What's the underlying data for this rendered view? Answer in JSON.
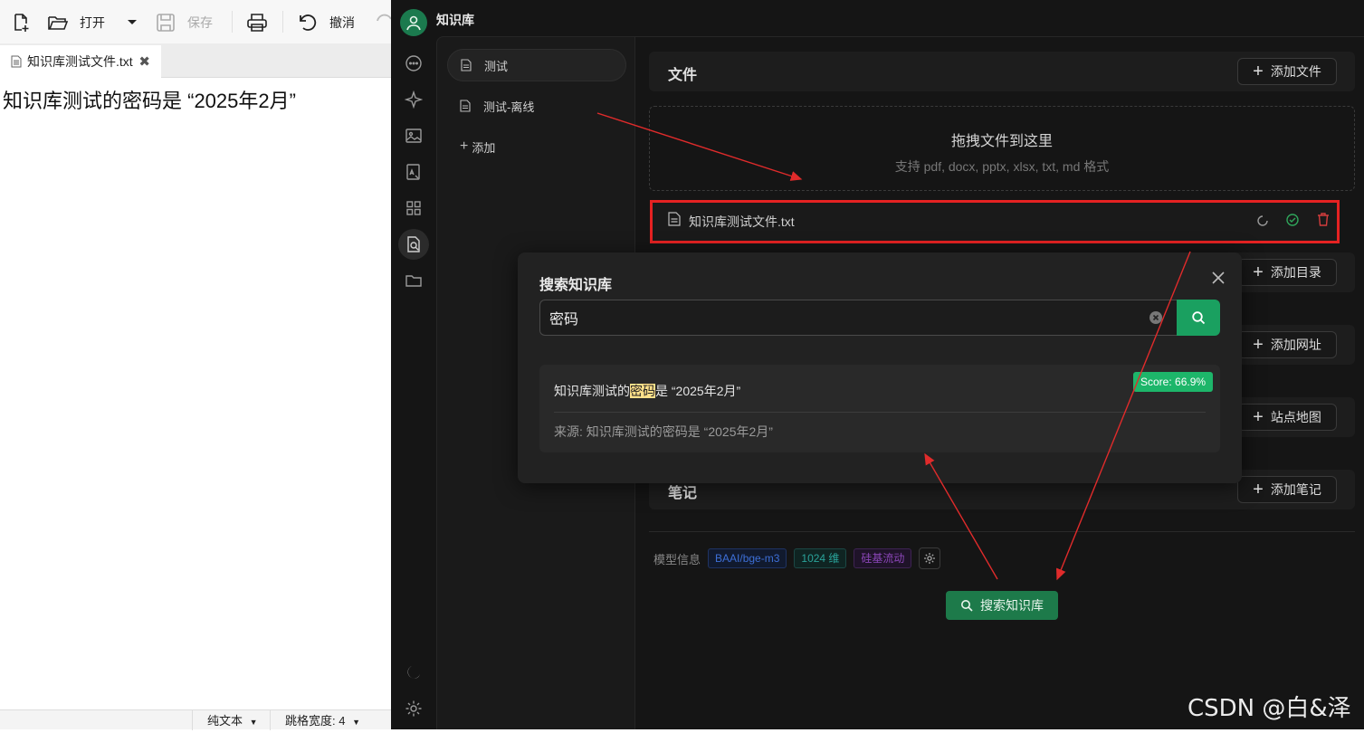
{
  "editor": {
    "toolbar": {
      "open": "打开",
      "save": "保存",
      "undo": "撤消"
    },
    "tab": {
      "title": "知识库测试文件.txt"
    },
    "content": "知识库测试的密码是 “2025年2月”",
    "status": {
      "mode": "纯文本",
      "tab_width": "跳格宽度: 4"
    }
  },
  "app": {
    "title": "知识库",
    "kb_items": [
      {
        "label": "测试"
      },
      {
        "label": "测试-离线"
      }
    ],
    "add_kb": "添加",
    "sections": {
      "files": {
        "title": "文件",
        "add": "添加文件"
      },
      "directory": {
        "add": "添加目录"
      },
      "url": {
        "add": "添加网址"
      },
      "sitemap": {
        "add": "站点地图"
      },
      "notes": {
        "title": "笔记",
        "add": "添加笔记"
      }
    },
    "dropzone": {
      "title": "拖拽文件到这里",
      "subtitle": "支持 pdf, docx, pptx, xlsx, txt, md 格式"
    },
    "file": {
      "name": "知识库测试文件.txt"
    },
    "model_info": {
      "label": "模型信息",
      "model": "BAAI/bge-m3",
      "dims": "1024 维",
      "provider": "硅基流动"
    },
    "search_button": "搜索知识库"
  },
  "modal": {
    "title": "搜索知识库",
    "query": "密码",
    "result": {
      "before": "知识库测试的",
      "highlight": "密码",
      "after": "是 “2025年2月”",
      "score": "Score: 66.9%",
      "source": "来源: 知识库测试的密码是 “2025年2月”"
    }
  },
  "watermark": "CSDN @白&泽",
  "colors": {
    "accent": "#1d7a4a",
    "highlight_border": "#e52222",
    "score_badge": "#1db66a",
    "arrow": "#e02b2b"
  }
}
